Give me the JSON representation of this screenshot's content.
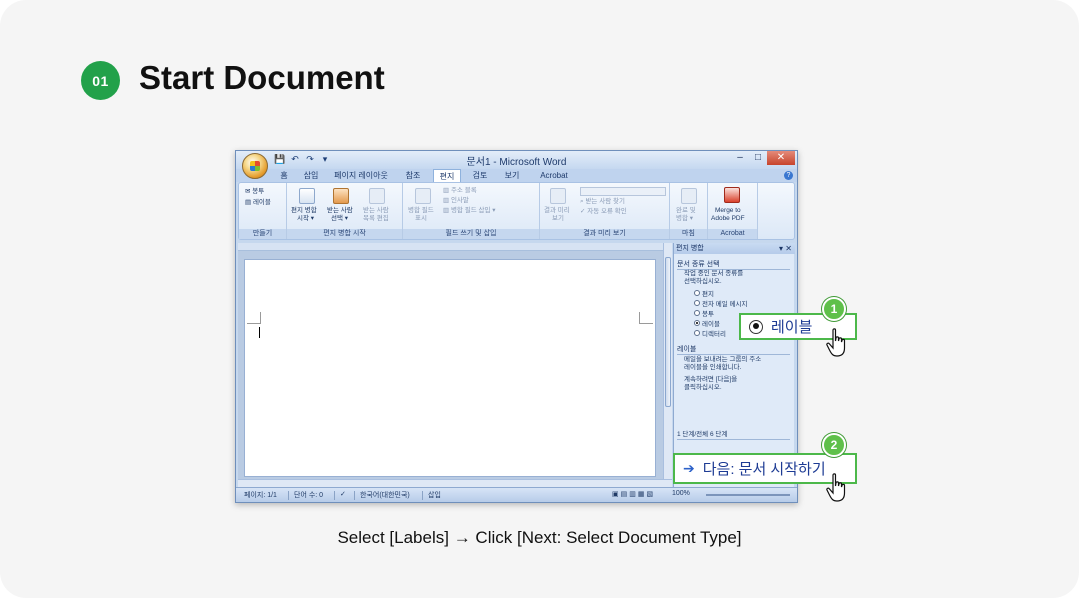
{
  "step": {
    "number": "01",
    "title": "Start Document"
  },
  "caption": "Select [Labels] → Click [Next: Select Document Type]",
  "window": {
    "title": "문서1 - Microsoft Word",
    "controls": {
      "minimize": "–",
      "restore": "□",
      "close": "✕"
    },
    "qat": [
      "💾",
      "↶",
      "↷",
      "▾"
    ]
  },
  "tabs": [
    {
      "label": "홈"
    },
    {
      "label": "삽입"
    },
    {
      "label": "페이지 레이아웃"
    },
    {
      "label": "참조"
    },
    {
      "label": "편지"
    },
    {
      "label": "검토"
    },
    {
      "label": "보기"
    },
    {
      "label": "Acrobat"
    }
  ],
  "active_tab": "편지",
  "ribbon": {
    "groups": [
      {
        "label": "만들기",
        "items": [
          "봉투",
          "레이블"
        ]
      },
      {
        "label": "편지 병합 시작",
        "items": [
          "편지 병합",
          "시작 ▾",
          "받는 사람",
          "선택 ▾",
          "받는 사람",
          "목록 편집"
        ]
      },
      {
        "label": "필드 쓰기 및 삽입",
        "items": [
          "병합 필드",
          "표시",
          "주소 블록",
          "인사말",
          "병합 필드 삽입 ▾"
        ]
      },
      {
        "label": "결과 미리 보기",
        "items": [
          "결과 미리",
          "보기",
          "받는 사람 찾기",
          "자동 오류 확인"
        ]
      },
      {
        "label": "마침",
        "items": [
          "완료 및",
          "병합 ▾"
        ]
      },
      {
        "label": "Acrobat",
        "items": [
          "Merge to",
          "Adobe PDF"
        ]
      }
    ]
  },
  "pane": {
    "title": "편지 병합",
    "section1": "문서 종류 선택",
    "instruction1": [
      "작업 중인 문서 종류를",
      "선택하십시오."
    ],
    "options": [
      "편지",
      "전자 메일 메시지",
      "봉투",
      "레이블",
      "디렉터리"
    ],
    "selected_option": "레이블",
    "section2": "레이블",
    "instruction2": [
      "메일을 보내려는 그룹의 주소",
      "레이블을 인쇄합니다."
    ],
    "instruction3": [
      "계속하려면 [다음]을",
      "클릭하십시오."
    ],
    "step_status": "1 단계/전체 6 단계",
    "next_label": "다음: 문서 시작하기"
  },
  "statusbar": {
    "page": "페이지: 1/1",
    "words": "단어 수: 0",
    "language": "한국어(대한민국)",
    "mode": "삽입",
    "zoom": "100%"
  },
  "callouts": [
    {
      "number": "1",
      "label": "레이블"
    },
    {
      "number": "2",
      "label": "다음: 문서 시작하기",
      "arrow": "➔"
    }
  ],
  "colors": {
    "accent_green": "#22a14a",
    "callout_green": "#4cb84a",
    "text_blue": "#1d3b94"
  }
}
